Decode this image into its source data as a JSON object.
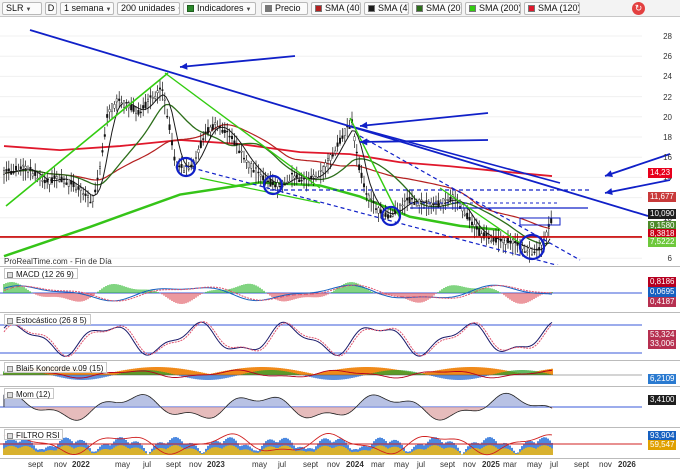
{
  "toolbar": {
    "symbol": "SLR",
    "chart_type": "D",
    "timeframe": "1 semana",
    "units": "200 unidades",
    "indicators": "Indicadores",
    "legend": [
      {
        "label": "Precio",
        "color": "#777777"
      },
      {
        "label": "SMA (40)",
        "color": "#b52020"
      },
      {
        "label": "SMA (4)",
        "color": "#1a1a1a"
      },
      {
        "label": "SMA (20)",
        "color": "#2c6e1a"
      },
      {
        "label": "SMA (200)",
        "color": "#33cc11"
      },
      {
        "label": "SMA (120)",
        "color": "#e0182c"
      }
    ]
  },
  "price_panel": {
    "source": "ProRealTime.com - Fin de Día",
    "y_axis": [
      "28",
      "26",
      "24",
      "22",
      "20",
      "18",
      "16",
      "14",
      "12",
      "10",
      "8",
      "6"
    ],
    "price_tags": [
      {
        "value": "14,23",
        "color": "#e8001c"
      },
      {
        "value": "11,677",
        "color": "#c83a3a"
      },
      {
        "value": "10,090",
        "color": "#1e1e1e"
      },
      {
        "value": "9,1580",
        "color": "#4d8a2a"
      },
      {
        "value": "8,3818",
        "color": "#c80018"
      },
      {
        "value": "7,5222",
        "color": "#6ec83c"
      }
    ]
  },
  "macd_panel": {
    "title": "MACD (12 26 9)",
    "tags": [
      "0,8186",
      "0,0695",
      "0,4187"
    ],
    "tag_colors": [
      "#b60020",
      "#1660c0",
      "#b63050"
    ]
  },
  "stoch_panel": {
    "title": "Estocástico (26 8 5)",
    "tags": [
      "53,324",
      "33,006"
    ],
    "tag_colors": [
      "#b63050",
      "#b63050"
    ]
  },
  "blai_panel": {
    "title": "Blai5 Koncorde v.09 (15)",
    "tags": [
      "6,2109"
    ],
    "tag_colors": [
      "#2a7ad0"
    ]
  },
  "mom_panel": {
    "title": "Mom (12)",
    "tags": [
      "3,4100"
    ],
    "tag_colors": [
      "#1e1e1e"
    ]
  },
  "rsi_panel": {
    "title": "FILTRO RSI",
    "tags": [
      "93,904",
      "59,547"
    ],
    "tag_colors": [
      "#1660c0",
      "#e0a000"
    ]
  },
  "x_axis": [
    "sept",
    "nov",
    "2022",
    "may",
    "jul",
    "sept",
    "nov",
    "2023",
    "may",
    "jul",
    "sept",
    "nov",
    "2024",
    "mar",
    "may",
    "jul",
    "sept",
    "nov",
    "2025",
    "mar",
    "may",
    "jul",
    "sept",
    "nov",
    "2026"
  ]
}
